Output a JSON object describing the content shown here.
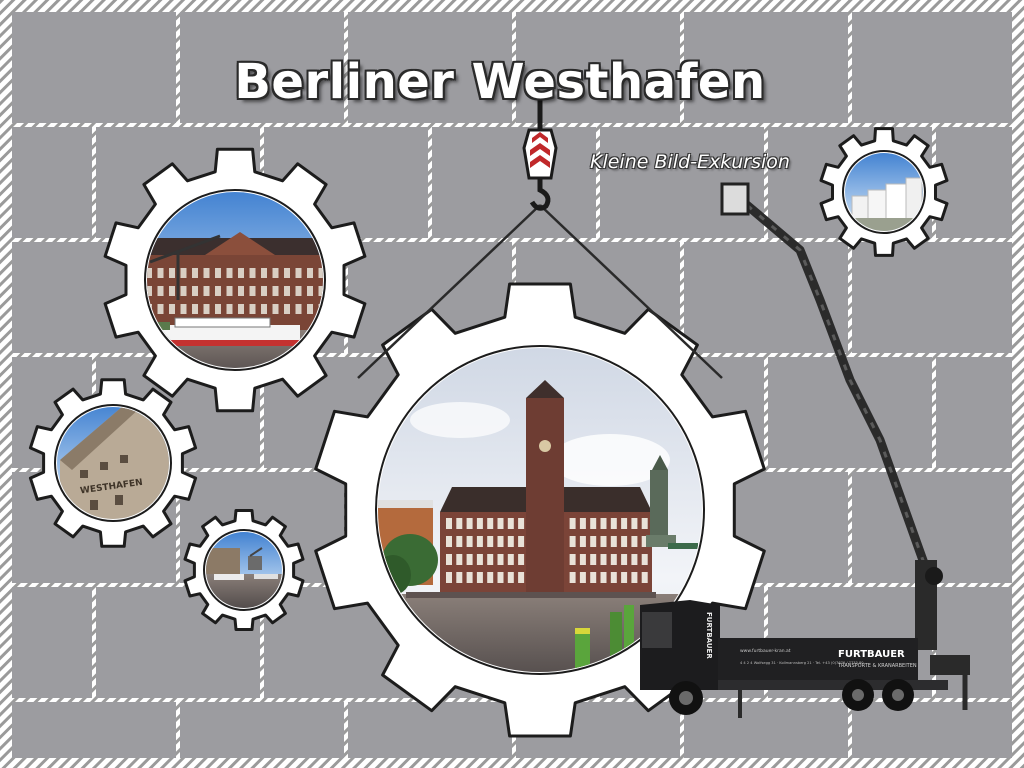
{
  "poster": {
    "title": "Berliner Westhafen",
    "subtitle": "Kleine Bild-Exkursion"
  },
  "photo_labels": {
    "warehouse_sign": "WESTHAFEN"
  },
  "truck": {
    "brand": "FURTBAUER",
    "tagline": "TRANSPORTE & KRANARBEITEN",
    "cab_brand": "FURTBAUER",
    "website": "www.furtbauer-kran.at",
    "contact_line": "4 4 2 4 Wolfsegg 31 · Kollmannsberg 21 · Tel. +43 (0)7676 / 7733 80"
  },
  "colors": {
    "wall": "#9c9ca0",
    "mortar": "#ffffff",
    "gear": "#ffffff",
    "outline": "#1c1c1c",
    "truck": "#202022",
    "hook_red": "#c0282a"
  }
}
